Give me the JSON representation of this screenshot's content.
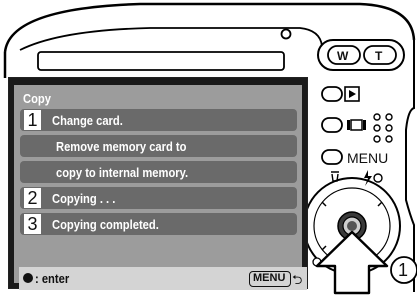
{
  "menu": {
    "title": "Copy",
    "items": [
      {
        "number": "1",
        "label": "Change card."
      },
      {
        "label": "Remove memory card to"
      },
      {
        "label": "copy to internal memory."
      },
      {
        "number": "2",
        "label": "Copying . . ."
      },
      {
        "number": "3",
        "label": "Copying completed."
      }
    ]
  },
  "footer": {
    "enter_label": ": enter",
    "menu_button_label": "MENU"
  },
  "camera": {
    "wide_label": "W",
    "tele_label": "T",
    "menu_label": "MENU"
  },
  "callout": {
    "number": "1"
  }
}
